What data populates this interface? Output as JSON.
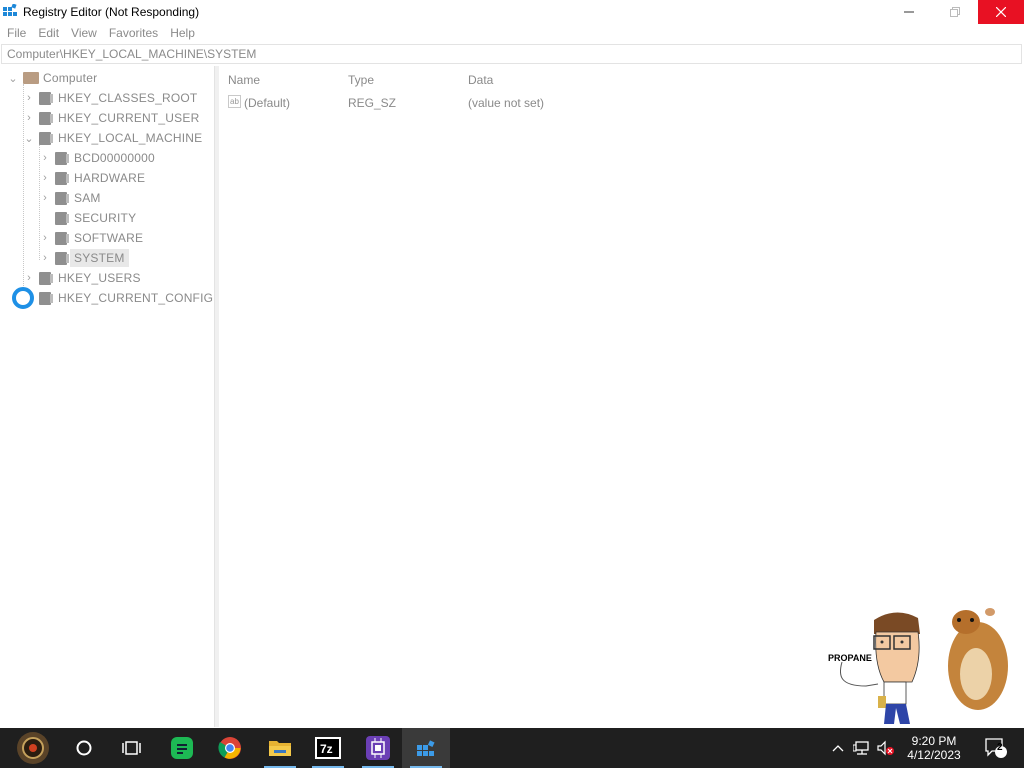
{
  "window": {
    "title": "Registry Editor (Not Responding)",
    "buttons": {
      "minimize": "—",
      "maximize": "❐",
      "close": "✕"
    }
  },
  "menu": [
    "File",
    "Edit",
    "View",
    "Favorites",
    "Help"
  ],
  "address": "Computer\\HKEY_LOCAL_MACHINE\\SYSTEM",
  "tree": {
    "root": "Computer",
    "items": [
      {
        "label": "HKEY_CLASSES_ROOT",
        "expanded": false
      },
      {
        "label": "HKEY_CURRENT_USER",
        "expanded": false
      },
      {
        "label": "HKEY_LOCAL_MACHINE",
        "expanded": true
      },
      {
        "label": "BCD00000000",
        "expanded": false
      },
      {
        "label": "HARDWARE",
        "expanded": false
      },
      {
        "label": "SAM",
        "expanded": false
      },
      {
        "label": "SECURITY",
        "expanded": false
      },
      {
        "label": "SOFTWARE",
        "expanded": false
      },
      {
        "label": "SYSTEM",
        "expanded": false,
        "selected": true
      },
      {
        "label": "HKEY_USERS",
        "expanded": false
      },
      {
        "label": "HKEY_CURRENT_CONFIG",
        "expanded": false
      }
    ]
  },
  "list": {
    "columns": [
      "Name",
      "Type",
      "Data"
    ],
    "rows": [
      {
        "name": "(Default)",
        "type": "REG_SZ",
        "data": "(value not set)",
        "icon": "string-value-icon"
      }
    ]
  },
  "overlay": {
    "caption": "PROPANE"
  },
  "taskbar": {
    "apps": [
      "start-button",
      "cortana-search",
      "task-view",
      "notes-app",
      "chrome",
      "file-explorer",
      "7zip",
      "cpu-app",
      "registry-editor"
    ],
    "time": "9:20 PM",
    "date": "4/12/2023",
    "notifications": "2"
  },
  "colors": {
    "close_red": "#e81123",
    "taskbar": "#1f1f1f",
    "busy_blue": "#1e90e6"
  }
}
